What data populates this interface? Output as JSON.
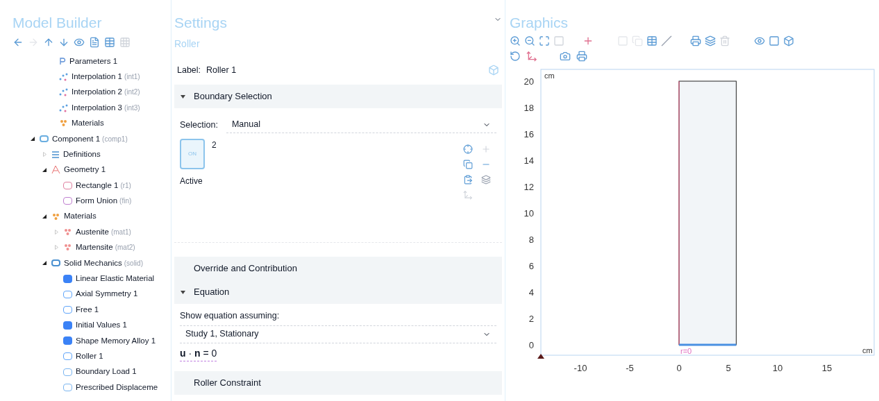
{
  "model_builder": {
    "title": "Model Builder",
    "tree": [
      {
        "label": "Parameters 1",
        "kind": "parameters"
      },
      {
        "label": "Interpolation 1",
        "tag": "(int1)",
        "kind": "interpolation"
      },
      {
        "label": "Interpolation 2",
        "tag": "(int2)",
        "kind": "interpolation"
      },
      {
        "label": "Interpolation 3",
        "tag": "(int3)",
        "kind": "interpolation"
      },
      {
        "label": "Materials",
        "kind": "materials"
      },
      {
        "label": "Component 1",
        "tag": "(comp1)",
        "kind": "component",
        "expanded": true,
        "children": [
          {
            "label": "Definitions",
            "kind": "definitions",
            "expanded": false
          },
          {
            "label": "Geometry 1",
            "kind": "geometry",
            "expanded": true,
            "children": [
              {
                "label": "Rectangle 1",
                "tag": "(r1)",
                "kind": "rectangle"
              },
              {
                "label": "Form Union",
                "tag": "(fin)",
                "kind": "union"
              }
            ]
          },
          {
            "label": "Materials",
            "kind": "materials",
            "expanded": true,
            "children": [
              {
                "label": "Austenite",
                "tag": "(mat1)",
                "kind": "material",
                "expanded": false
              },
              {
                "label": "Martensite",
                "tag": "(mat2)",
                "kind": "material",
                "expanded": false
              }
            ]
          },
          {
            "label": "Solid Mechanics",
            "tag": "(solid)",
            "kind": "physics",
            "expanded": true,
            "children": [
              {
                "label": "Linear Elastic Material",
                "kind": "domain"
              },
              {
                "label": "Axial Symmetry 1",
                "kind": "boundary"
              },
              {
                "label": "Free 1",
                "kind": "boundary"
              },
              {
                "label": "Initial Values 1",
                "kind": "domain"
              },
              {
                "label": "Shape Memory Alloy 1",
                "kind": "domain"
              },
              {
                "label": "Roller 1",
                "kind": "boundary"
              },
              {
                "label": "Boundary Load 1",
                "kind": "load"
              },
              {
                "label": "Prescribed Displaceme",
                "kind": "load"
              }
            ]
          }
        ]
      }
    ]
  },
  "settings": {
    "title": "Settings",
    "subtitle": "Roller",
    "label_caption": "Label:",
    "label_value": "Roller 1",
    "sections": [
      {
        "kind": "selection",
        "title": "Boundary Selection",
        "expanded": true,
        "caption": "Selection:",
        "value": "Manual",
        "items": [
          "2"
        ],
        "toggle_text": "ON",
        "toggle_caption": "Active"
      },
      {
        "kind": "plain",
        "title": "Override and Contribution",
        "expanded": false
      },
      {
        "kind": "equation",
        "title": "Equation",
        "expanded": true,
        "caption": "Show equation assuming:",
        "value": "Study 1, Stationary",
        "formula": "**u** · **n** = 0"
      },
      {
        "kind": "plain",
        "title": "Roller Constraint",
        "expanded": false
      }
    ]
  },
  "graphics": {
    "title": "Graphics",
    "y_unit": "cm",
    "x_unit": "cm",
    "edge_label": "r=0",
    "x_ticks": [
      "-10",
      "-5",
      "0",
      "5",
      "10",
      "15"
    ],
    "y_ticks": [
      "20",
      "18",
      "16",
      "14",
      "12",
      "10",
      "8",
      "6",
      "4",
      "2",
      "0"
    ]
  }
}
